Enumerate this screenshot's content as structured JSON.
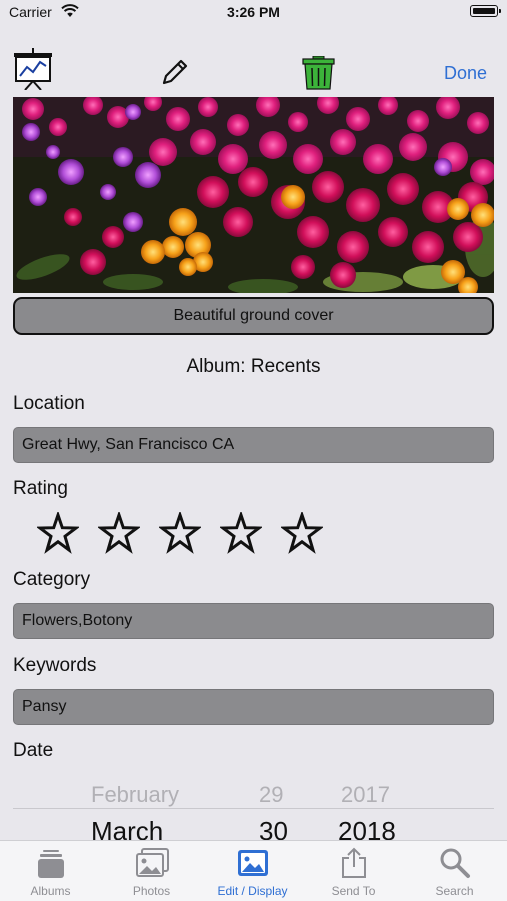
{
  "status": {
    "carrier": "Carrier",
    "time": "3:26 PM"
  },
  "toolbar": {
    "slideshow_icon": "presentation-chart-icon",
    "edit_icon": "pencil-icon",
    "delete_icon": "trash-icon",
    "done_label": "Done",
    "delete_color": "#3cb33a",
    "accent": "#2f6fd3"
  },
  "photo": {
    "subject": "pink and orange ground-cover flowers"
  },
  "caption": "Beautiful ground cover",
  "album": "Album: Recents",
  "location": {
    "label": "Location",
    "value": "Great Hwy, San Francisco CA"
  },
  "rating": {
    "label": "Rating",
    "value": 0,
    "max": 5
  },
  "category": {
    "label": "Category",
    "value": "Flowers,Botony"
  },
  "keywords": {
    "label": "Keywords",
    "value": "Pansy"
  },
  "date": {
    "label": "Date",
    "prev": {
      "month": "February",
      "day": "29",
      "year": "2017"
    },
    "selected": {
      "month": "March",
      "day": "30",
      "year": "2018"
    }
  },
  "tabs": [
    {
      "label": "Albums",
      "icon": "albums-icon"
    },
    {
      "label": "Photos",
      "icon": "photos-icon"
    },
    {
      "label": "Edit / Display",
      "icon": "edit-display-icon",
      "active": true
    },
    {
      "label": "Send To",
      "icon": "share-icon"
    },
    {
      "label": "Search",
      "icon": "search-icon"
    }
  ]
}
